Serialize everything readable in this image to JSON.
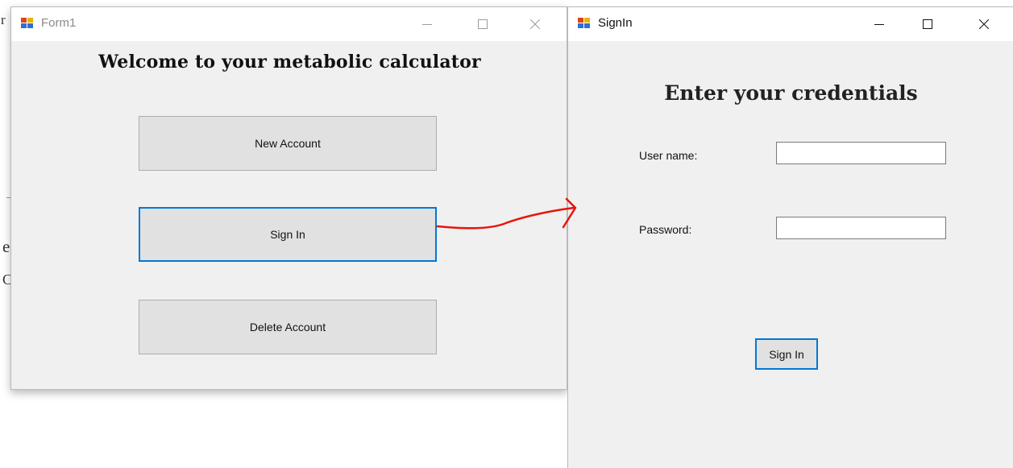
{
  "form1": {
    "title": "Form1",
    "welcome": "Welcome to your metabolic calculator",
    "buttons": {
      "new_account": "New Account",
      "sign_in": "Sign In",
      "delete_account": "Delete Account"
    }
  },
  "signin": {
    "title": "SignIn",
    "heading": "Enter your credentials",
    "username_label": "User name:",
    "username_value": "",
    "password_label": "Password:",
    "password_value": "",
    "sign_in_button": "Sign In"
  },
  "background_fragments": [
    "r",
    "e",
    "C"
  ],
  "colors": {
    "window_bg": "#f0f0f0",
    "button_bg": "#e1e1e1",
    "focus_border": "#0078d7",
    "arrow": "#e8140c"
  },
  "icons": [
    "form-app-icon",
    "minimize-icon",
    "maximize-icon",
    "close-icon"
  ]
}
